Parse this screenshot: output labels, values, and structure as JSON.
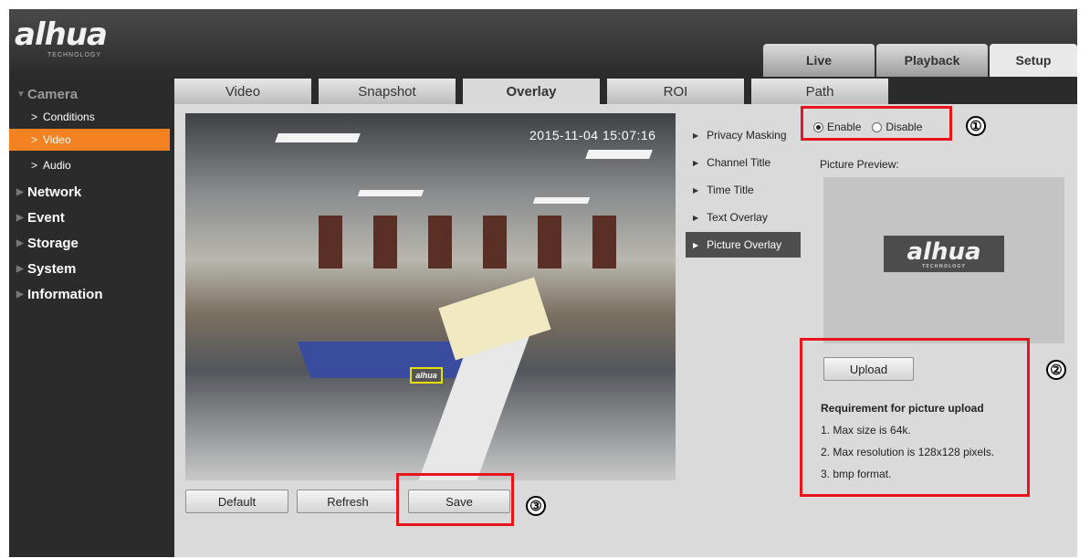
{
  "header": {
    "logo": "alhua",
    "logo_sub": "TECHNOLOGY",
    "tabs": [
      {
        "label": "Live"
      },
      {
        "label": "Playback"
      },
      {
        "label": "Setup"
      }
    ],
    "active_tab": "Setup"
  },
  "sidebar": {
    "camera": "Camera",
    "camera_items": [
      {
        "label": "Conditions"
      },
      {
        "label": "Video"
      },
      {
        "label": "Audio"
      }
    ],
    "active_item": "Video",
    "sections": [
      {
        "label": "Network"
      },
      {
        "label": "Event"
      },
      {
        "label": "Storage"
      },
      {
        "label": "System"
      },
      {
        "label": "Information"
      }
    ]
  },
  "subtabs": [
    {
      "label": "Video"
    },
    {
      "label": "Snapshot"
    },
    {
      "label": "Overlay"
    },
    {
      "label": "ROI"
    },
    {
      "label": "Path"
    }
  ],
  "active_subtab": "Overlay",
  "video": {
    "osd_time": "2015-11-04 15:07:16",
    "watermark": "alhua"
  },
  "buttons": {
    "default": "Default",
    "refresh": "Refresh",
    "save": "Save",
    "upload": "Upload"
  },
  "overlay_menu": [
    {
      "label": "Privacy Masking"
    },
    {
      "label": "Channel Title"
    },
    {
      "label": "Time Title"
    },
    {
      "label": "Text Overlay"
    },
    {
      "label": "Picture Overlay"
    }
  ],
  "active_overlay": "Picture Overlay",
  "picture_overlay": {
    "enable_label": "Enable",
    "disable_label": "Disable",
    "selected": "Enable",
    "preview_label": "Picture Preview:",
    "preview_logo": "alhua",
    "preview_logo_sub": "TECHNOLOGY",
    "req_title": "Requirement for picture upload",
    "req_lines": [
      "1. Max size is 64k.",
      "2. Max resolution is 128x128 pixels.",
      "3. bmp format."
    ]
  },
  "callouts": [
    "①",
    "②",
    "③"
  ],
  "colors": {
    "accent": "#f58220",
    "callout": "#e8141c",
    "active_menu": "#4e4e4e"
  }
}
